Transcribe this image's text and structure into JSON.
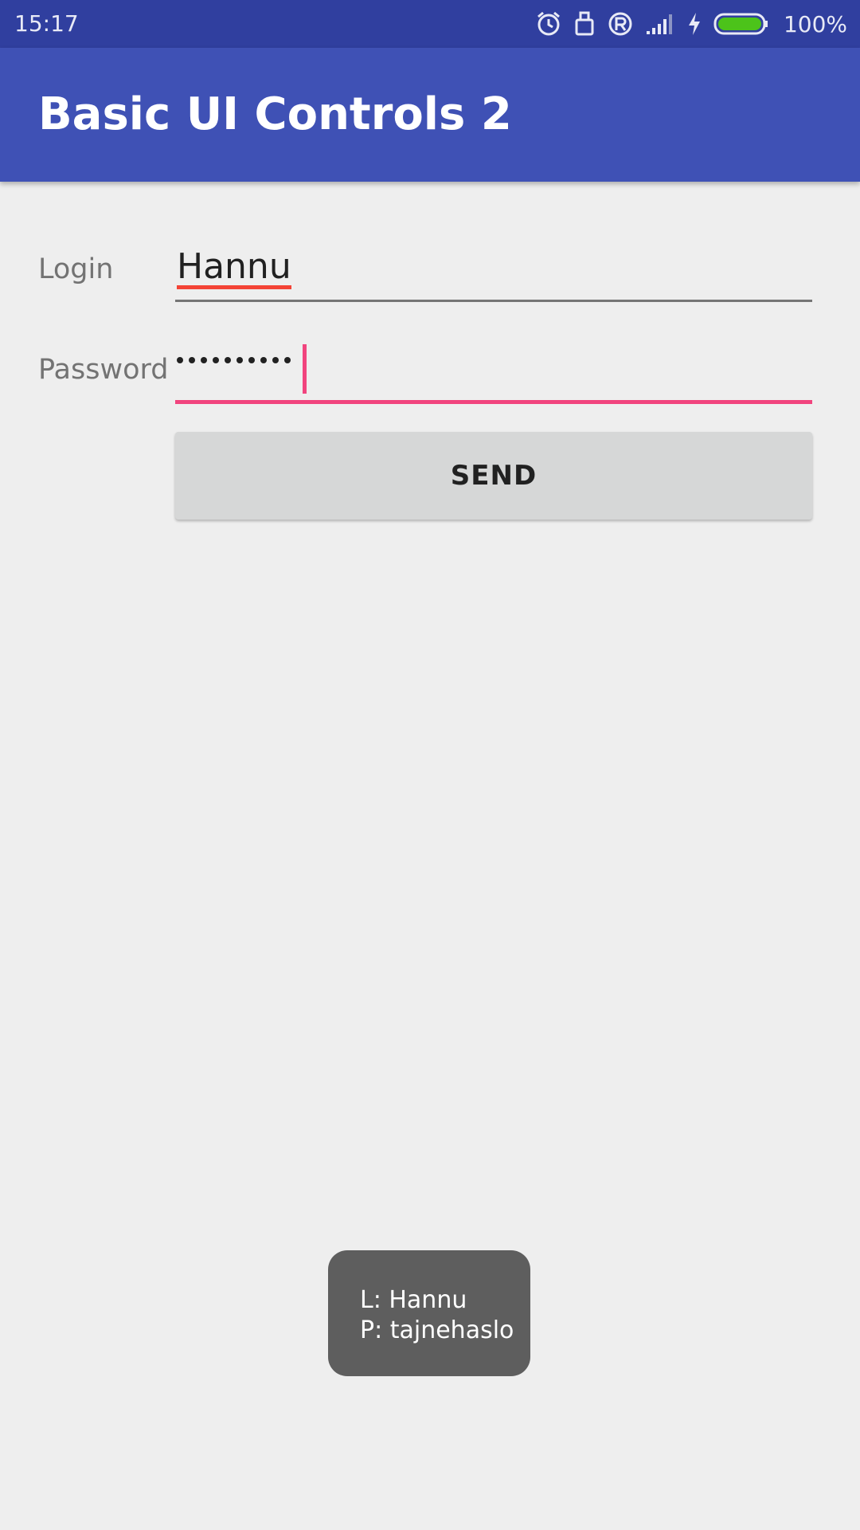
{
  "status_bar": {
    "time": "15:17",
    "battery_percent": "100%",
    "battery_level": 1.0,
    "icons": [
      "alarm-icon",
      "device-icon",
      "registered-icon",
      "signal-icon",
      "charging-icon",
      "battery-icon"
    ]
  },
  "app_bar": {
    "title": "Basic UI Controls 2",
    "color": "#3f51b5"
  },
  "form": {
    "login_label": "Login",
    "login_value": "Hannu",
    "password_label": "Password",
    "password_masked": "••••••••••",
    "send_label": "SEND"
  },
  "toast": {
    "line1": "L: Hannu",
    "line2": "P: tajnehaslo"
  },
  "colors": {
    "status_bar": "#303f9f",
    "accent": "#f1447e",
    "background": "#eeeeee"
  }
}
